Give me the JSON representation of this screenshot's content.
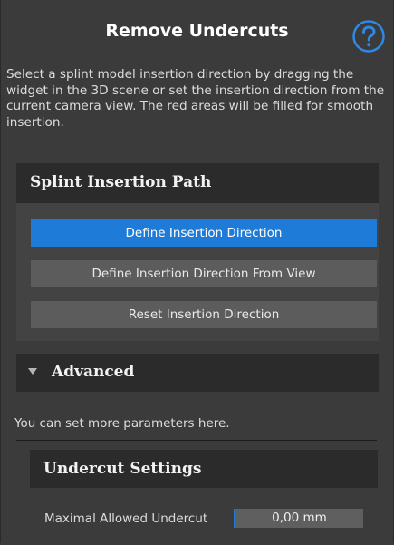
{
  "header": {
    "title": "Remove Undercuts",
    "help_icon": "question-circle-icon"
  },
  "description": "Select a splint model insertion direction by dragging the widget in the 3D scene or set the insertion direction from the current camera view. The red areas will be filled for smooth insertion.",
  "insertion_path": {
    "title": "Splint Insertion Path",
    "buttons": [
      {
        "label": "Define Insertion Direction",
        "active": true
      },
      {
        "label": "Define Insertion Direction From View",
        "active": false
      },
      {
        "label": "Reset Insertion Direction",
        "active": false
      }
    ]
  },
  "advanced": {
    "title": "Advanced",
    "expanded": true,
    "description": "You can set more parameters here.",
    "undercut_settings": {
      "title": "Undercut Settings",
      "field_label": "Maximal Allowed Undercut",
      "field_value": "0,00 mm"
    }
  },
  "colors": {
    "accent": "#1f7bd8",
    "panel_bg": "#3b3b3b",
    "header_bg": "#2b2b2b"
  }
}
